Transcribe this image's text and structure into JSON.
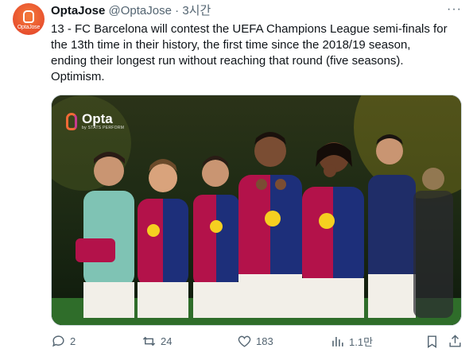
{
  "author": {
    "avatar_text": "OptaJose",
    "display_name": "OptaJose",
    "handle": "@OptaJose",
    "separator": "·",
    "time": "3시간"
  },
  "more_label": "···",
  "tweet_text": "13 - FC Barcelona will contest the UEFA Champions League semi-finals for\nthe 13th time in their history, the first time since the 2018/19 season,\nending their longest run without reaching that round (five seasons).\nOptimism.",
  "media": {
    "watermark_main": "Opta",
    "watermark_sub": "by STATS PERFORM"
  },
  "actions": {
    "replies": "2",
    "reposts": "24",
    "likes": "183",
    "views": "1.1만"
  },
  "colors": {
    "accent_orange": "#e8502e",
    "text_primary": "#0f1419",
    "text_secondary": "#536471",
    "border": "#cfd9de"
  }
}
